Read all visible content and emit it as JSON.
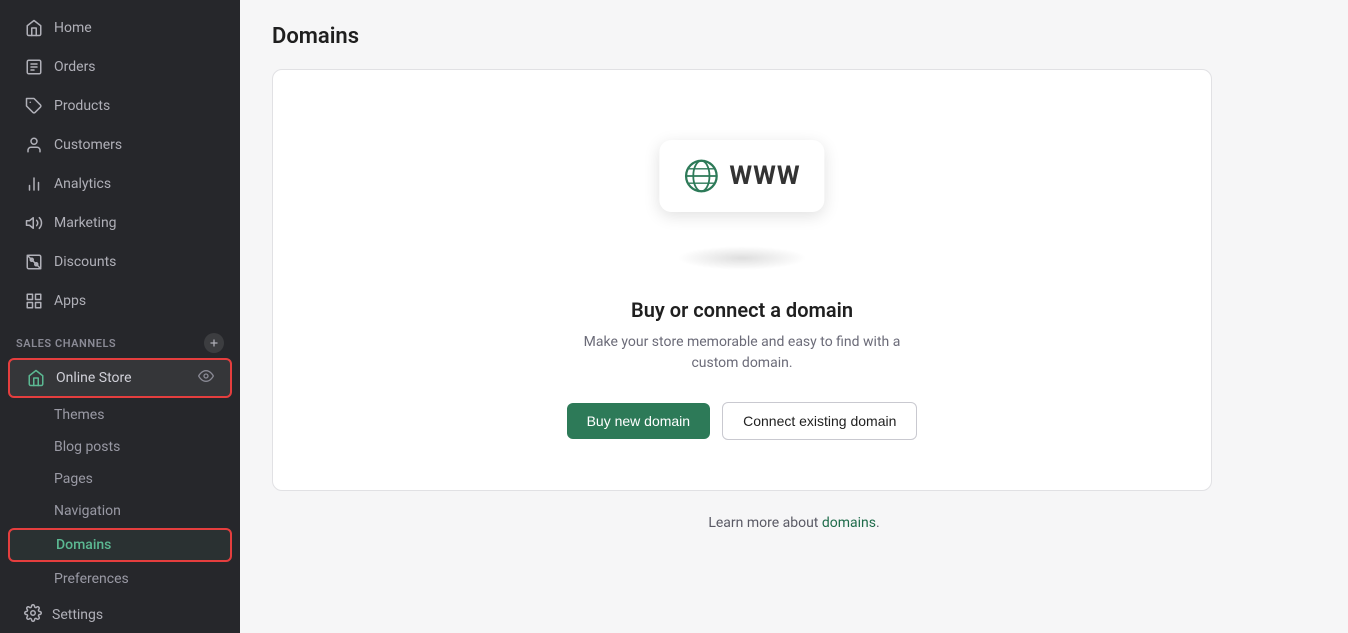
{
  "sidebar": {
    "nav_items": [
      {
        "id": "home",
        "label": "Home",
        "icon": "home"
      },
      {
        "id": "orders",
        "label": "Orders",
        "icon": "orders"
      },
      {
        "id": "products",
        "label": "Products",
        "icon": "products"
      },
      {
        "id": "customers",
        "label": "Customers",
        "icon": "customers"
      },
      {
        "id": "analytics",
        "label": "Analytics",
        "icon": "analytics"
      },
      {
        "id": "marketing",
        "label": "Marketing",
        "icon": "marketing"
      },
      {
        "id": "discounts",
        "label": "Discounts",
        "icon": "discounts"
      },
      {
        "id": "apps",
        "label": "Apps",
        "icon": "apps"
      }
    ],
    "sales_channels_label": "SALES CHANNELS",
    "online_store_label": "Online Store",
    "sub_items": [
      {
        "id": "themes",
        "label": "Themes"
      },
      {
        "id": "blog-posts",
        "label": "Blog posts"
      },
      {
        "id": "pages",
        "label": "Pages"
      },
      {
        "id": "navigation",
        "label": "Navigation"
      },
      {
        "id": "domains",
        "label": "Domains",
        "active": true
      },
      {
        "id": "preferences",
        "label": "Preferences"
      }
    ],
    "settings_label": "Settings"
  },
  "main": {
    "page_title": "Domains",
    "card": {
      "title": "Buy or connect a domain",
      "subtitle": "Make your store memorable and easy to find with a custom domain.",
      "btn_primary": "Buy new domain",
      "btn_secondary": "Connect existing domain",
      "learn_more_text": "Learn more about ",
      "learn_more_link": "domains",
      "learn_more_suffix": "."
    }
  },
  "icons": {
    "globe_color": "#2d7a58",
    "accent_green": "#2d7a58"
  }
}
